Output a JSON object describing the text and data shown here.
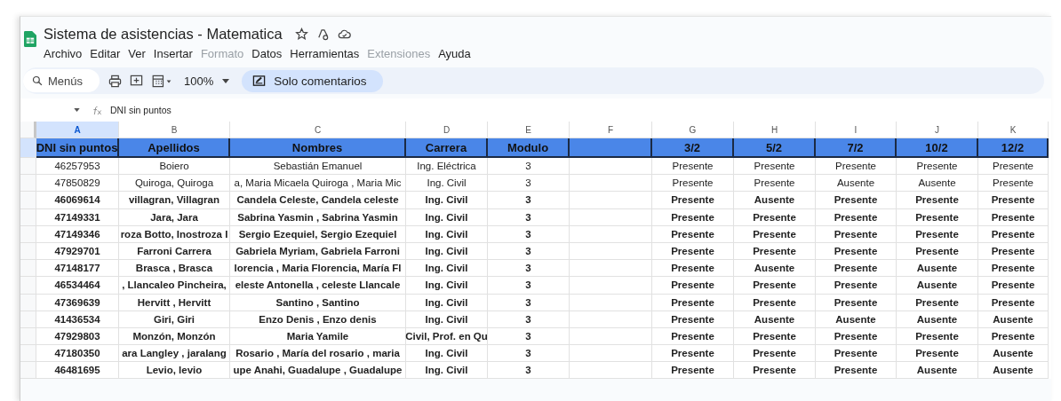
{
  "document": {
    "title": "Sistema de asistencias - Matematica"
  },
  "menu": [
    {
      "label": "Archivo",
      "disabled": false
    },
    {
      "label": "Editar",
      "disabled": false
    },
    {
      "label": "Ver",
      "disabled": false
    },
    {
      "label": "Insertar",
      "disabled": false
    },
    {
      "label": "Formato",
      "disabled": true
    },
    {
      "label": "Datos",
      "disabled": false
    },
    {
      "label": "Herramientas",
      "disabled": false
    },
    {
      "label": "Extensiones",
      "disabled": true
    },
    {
      "label": "Ayuda",
      "disabled": false
    }
  ],
  "toolbar": {
    "search": {
      "placeholder": "Menús"
    },
    "zoom": "100%",
    "mode_button": "Solo comentarios"
  },
  "formula_bar": {
    "value": "DNI sin puntos"
  },
  "sheet": {
    "columns": [
      {
        "letter": "A",
        "heading": "DNI sin puntos"
      },
      {
        "letter": "B",
        "heading": "Apellidos"
      },
      {
        "letter": "C",
        "heading": "Nombres"
      },
      {
        "letter": "D",
        "heading": "Carrera"
      },
      {
        "letter": "E",
        "heading": "Modulo"
      },
      {
        "letter": "F"
      },
      {
        "letter": "G",
        "heading": "3/2"
      },
      {
        "letter": "H",
        "heading": "5/2"
      },
      {
        "letter": "I",
        "heading": "7/2"
      },
      {
        "letter": "J",
        "heading": "10/2"
      },
      {
        "letter": "K",
        "heading": "12/2"
      }
    ],
    "rows": [
      {
        "bold": false,
        "cells": [
          "46257953",
          "Boiero",
          "Sebastián Emanuel",
          "Ing. Eléctrica",
          "3",
          "",
          "Presente",
          "Presente",
          "Presente",
          "Presente",
          "Presente"
        ]
      },
      {
        "bold": false,
        "cells": [
          "47850829",
          "Quiroga, Quiroga",
          "a, Maria Micaela Quiroga , Maria Mic",
          "Ing. Civil",
          "3",
          "",
          "Presente",
          "Presente",
          "Ausente",
          "Ausente",
          "Presente"
        ]
      },
      {
        "bold": true,
        "cells": [
          "46069614",
          "villagran, Villagran",
          "Candela Celeste, Candela celeste",
          "Ing. Civil",
          "3",
          "",
          "Presente",
          "Ausente",
          "Presente",
          "Presente",
          "Presente"
        ]
      },
      {
        "bold": true,
        "cells": [
          "47149331",
          "Jara, Jara",
          "Sabrina Yasmin , Sabrina Yasmin",
          "Ing. Civil",
          "3",
          "",
          "Presente",
          "Presente",
          "Presente",
          "Presente",
          "Presente"
        ]
      },
      {
        "bold": true,
        "cells": [
          "47149346",
          "roza Botto, Inostroza I",
          "Sergio Ezequiel, Sergio Ezequiel",
          "Ing. Civil",
          "3",
          "",
          "Presente",
          "Presente",
          "Presente",
          "Presente",
          "Presente"
        ]
      },
      {
        "bold": true,
        "cells": [
          "47929701",
          "Farroni Carrera",
          "Gabriela Myriam, Gabriela Farroni",
          "Ing. Civil",
          "3",
          "",
          "Presente",
          "Presente",
          "Presente",
          "Presente",
          "Presente"
        ]
      },
      {
        "bold": true,
        "cells": [
          "47148177",
          "Brasca , Brasca",
          "lorencia , Maria Florencia, María Fl",
          "Ing. Civil",
          "3",
          "",
          "Presente",
          "Ausente",
          "Presente",
          "Ausente",
          "Presente"
        ]
      },
      {
        "bold": true,
        "cells": [
          "46534464",
          ", Llancaleo Pincheira,",
          "eleste Antonella , celeste Llancale",
          "Ing. Civil",
          "3",
          "",
          "Presente",
          "Presente",
          "Presente",
          "Ausente",
          "Presente"
        ]
      },
      {
        "bold": true,
        "cells": [
          "47369639",
          "Hervitt , Hervitt",
          "Santino , Santino",
          "Ing. Civil",
          "3",
          "",
          "Presente",
          "Presente",
          "Presente",
          "Presente",
          "Presente"
        ]
      },
      {
        "bold": true,
        "cells": [
          "41436534",
          "Giri, Giri",
          "Enzo Denis , Enzo denis",
          "Ing. Civil",
          "3",
          "",
          "Presente",
          "Ausente",
          "Ausente",
          "Ausente",
          "Ausente"
        ]
      },
      {
        "bold": true,
        "cells": [
          "47929803",
          "Monzón, Monzón",
          "Maria Yamile",
          "Civil, Prof. en Qu",
          "3",
          "",
          "Presente",
          "Presente",
          "Presente",
          "Presente",
          "Presente"
        ]
      },
      {
        "bold": true,
        "cells": [
          "47180350",
          "ara Langley , jaralang",
          "Rosario , María del rosario , maria",
          "Ing. Civil",
          "3",
          "",
          "Presente",
          "Presente",
          "Presente",
          "Presente",
          "Ausente"
        ]
      },
      {
        "bold": true,
        "cells": [
          "46481695",
          "Levio, levio",
          "upe Anahi, Guadalupe , Guadalupe",
          "Ing. Civil",
          "3",
          "",
          "Presente",
          "Presente",
          "Presente",
          "Ausente",
          "Ausente"
        ]
      }
    ]
  }
}
